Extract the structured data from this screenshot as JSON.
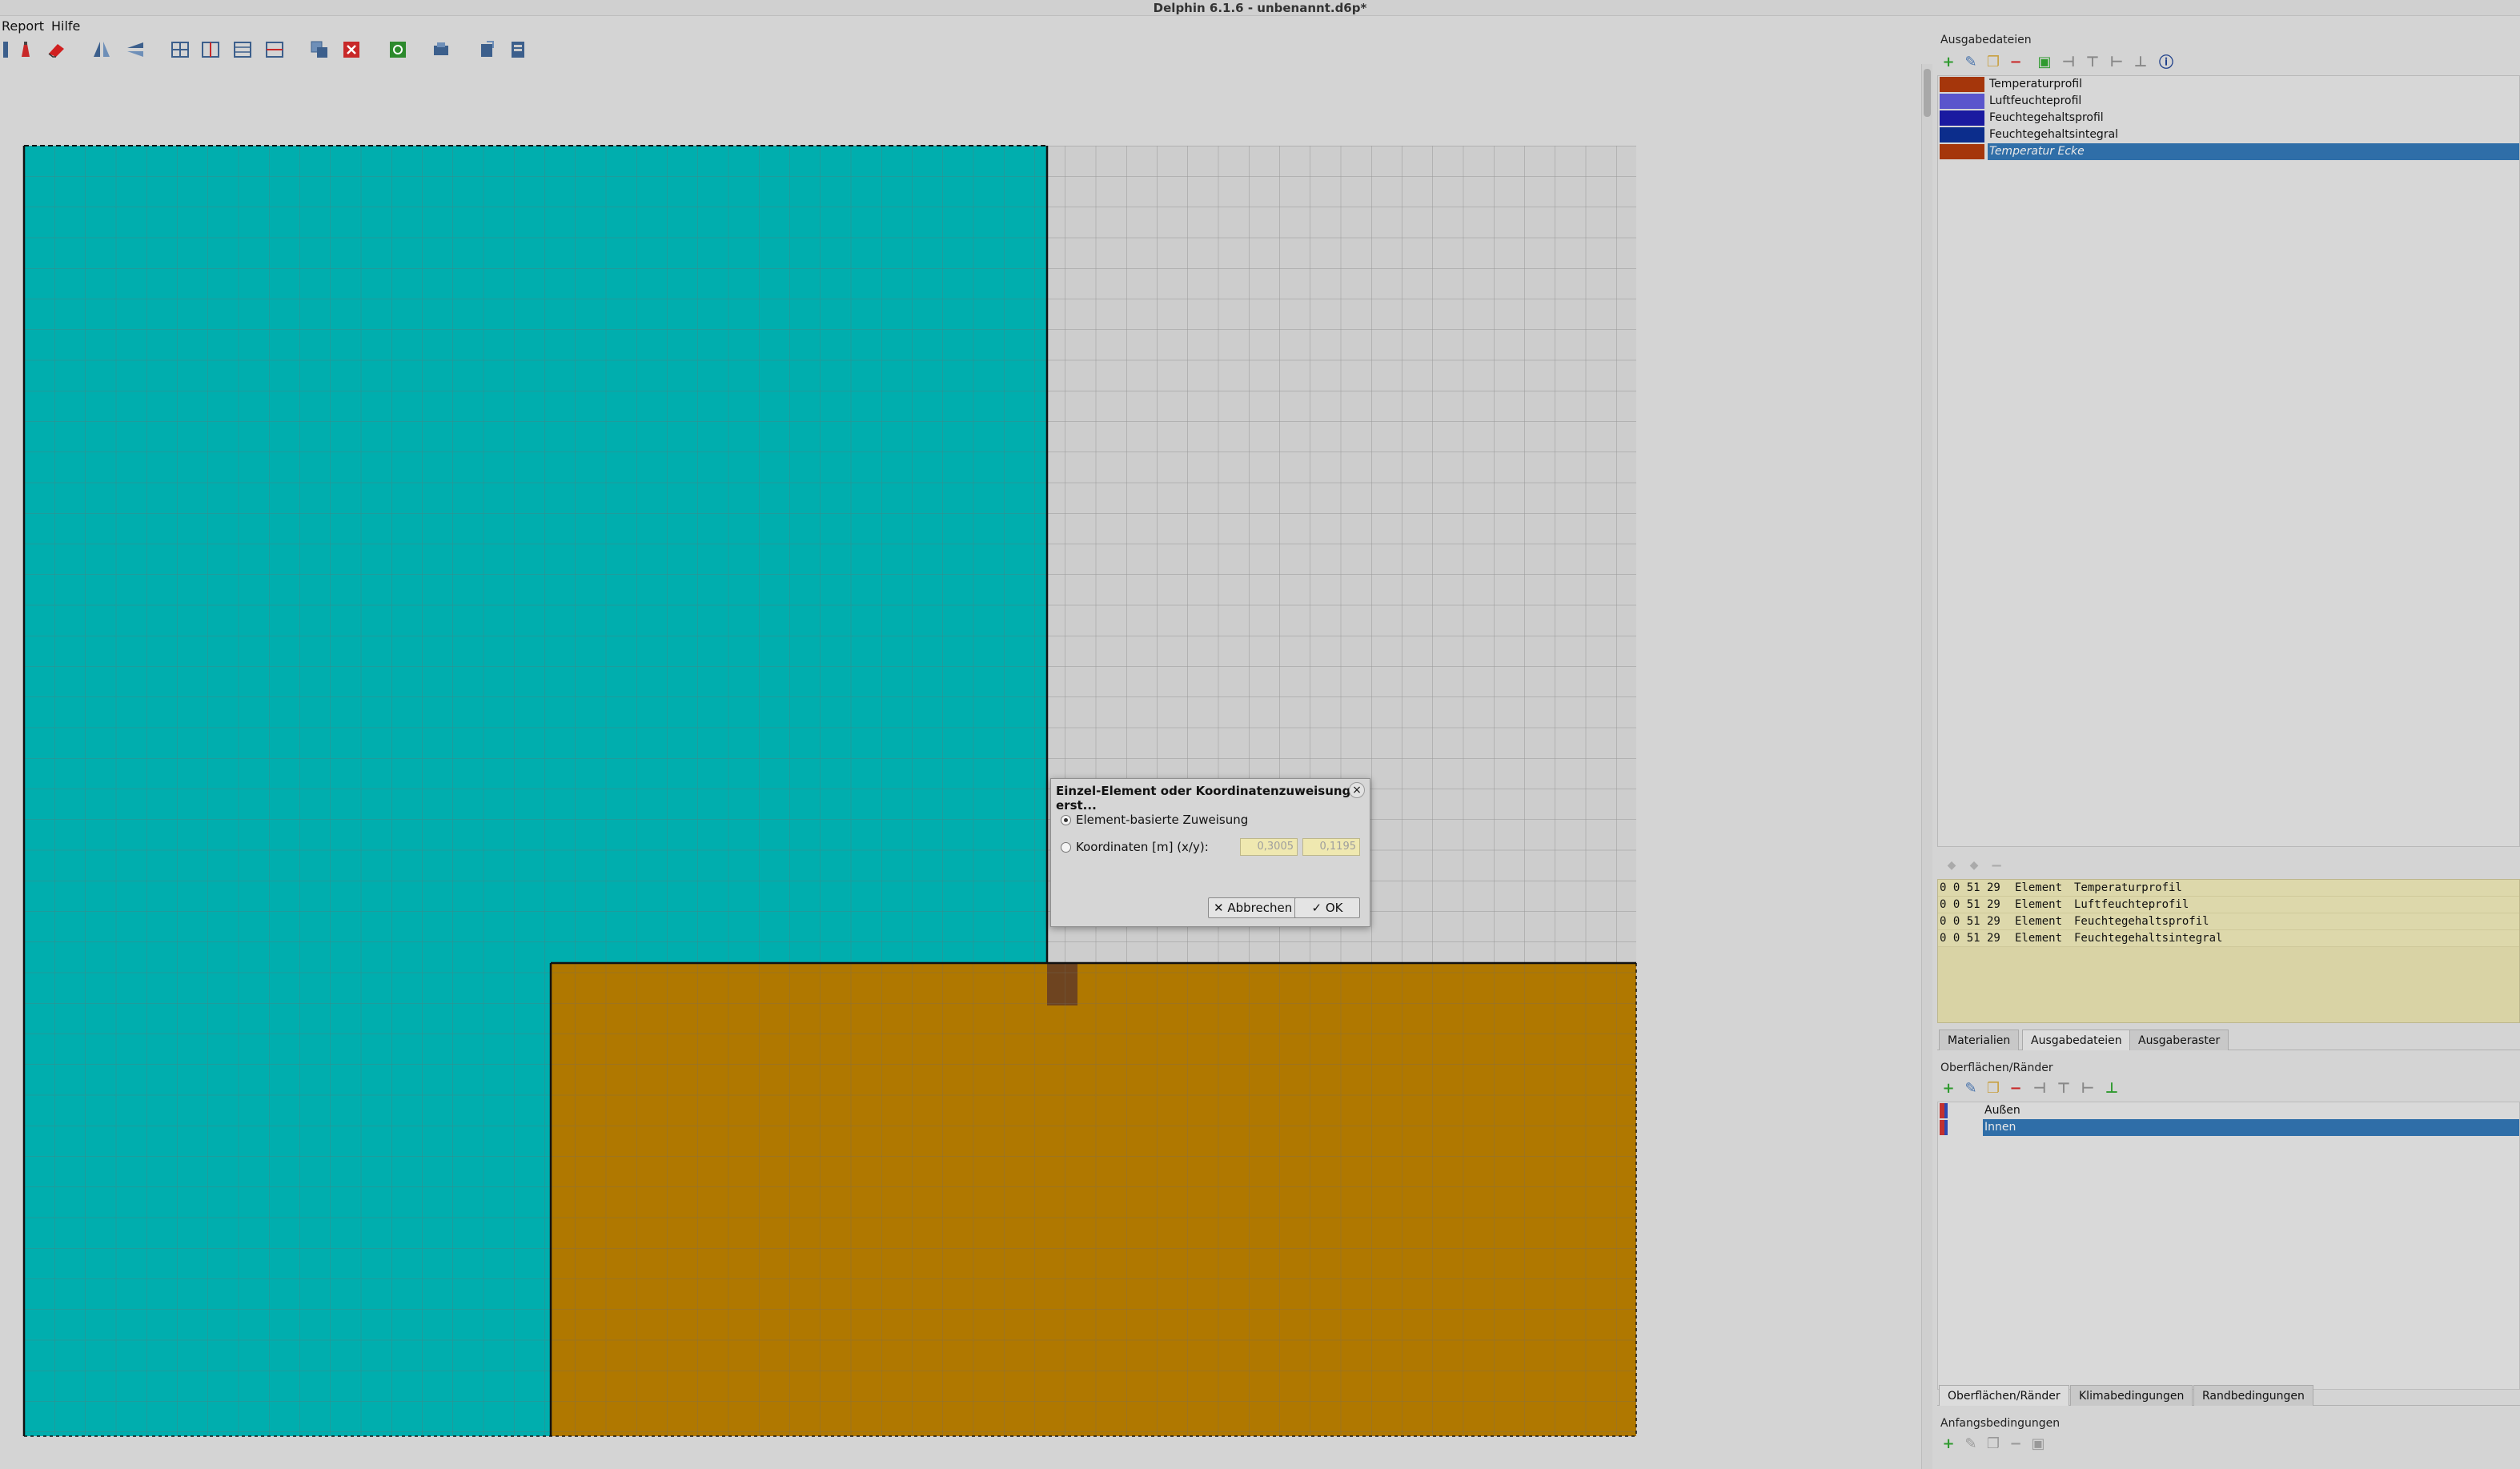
{
  "window": {
    "title": "Delphin 6.1.6 - unbenannt.d6p*"
  },
  "menu": {
    "items": [
      "Report",
      "Hilfe"
    ]
  },
  "toolbar": {
    "icons": [
      "ruler-icon",
      "pen-icon",
      "eraser-icon",
      "mirror-vertical-icon",
      "mirror-horizontal-icon",
      "grid-split-icon",
      "grid-merge-icon",
      "grid-insert-row-icon",
      "grid-delete-row-icon",
      "copy-region-icon",
      "delete-region-icon",
      "refresh-icon",
      "print-icon",
      "export-icon",
      "import-icon"
    ]
  },
  "colors": {
    "material_teal": "#00aeae",
    "material_ochre": "#b07800",
    "material_brown": "#6e4420",
    "selection": "#2f6ea8"
  },
  "output_files": {
    "label": "Ausgabedateien",
    "items": [
      {
        "name": "Temperaturprofil",
        "color": "#a5360b",
        "selected": false
      },
      {
        "name": "Luftfeuchteprofil",
        "color": "#5a55cc",
        "selected": false
      },
      {
        "name": "Feuchtegehaltsprofil",
        "color": "#1a1aa0",
        "selected": false
      },
      {
        "name": "Feuchtegehaltsintegral",
        "color": "#0c2d8c",
        "selected": false
      },
      {
        "name": "Temperatur Ecke",
        "color": "#a5360b",
        "selected": true
      }
    ]
  },
  "assignments": {
    "rows": [
      {
        "coords": "0 0 51 29",
        "type": "Element",
        "output": "Temperaturprofil"
      },
      {
        "coords": "0 0 51 29",
        "type": "Element",
        "output": "Luftfeuchteprofil"
      },
      {
        "coords": "0 0 51 29",
        "type": "Element",
        "output": "Feuchtegehaltsprofil"
      },
      {
        "coords": "0 0 51 29",
        "type": "Element",
        "output": "Feuchtegehaltsintegral"
      }
    ]
  },
  "tabs_top": [
    "Materialien",
    "Ausgabedateien",
    "Ausgaberaster"
  ],
  "surfaces": {
    "label": "Oberflächen/Ränder",
    "items": [
      {
        "name": "Außen",
        "selected": false
      },
      {
        "name": "Innen",
        "selected": true
      }
    ]
  },
  "tabs_bottom": [
    "Oberflächen/Ränder",
    "Klimabedingungen",
    "Randbedingungen"
  ],
  "initial_conditions": {
    "label": "Anfangsbedingungen"
  },
  "dialog": {
    "title": "Einzel-Element oder Koordinatenzuweisung erst...",
    "option_element": "Element-basierte Zuweisung",
    "option_coords": "Koordinaten [m] (x/y):",
    "x_value": "0,3005",
    "y_value": "0,1195",
    "cancel": "Abbrechen",
    "ok": "OK"
  }
}
